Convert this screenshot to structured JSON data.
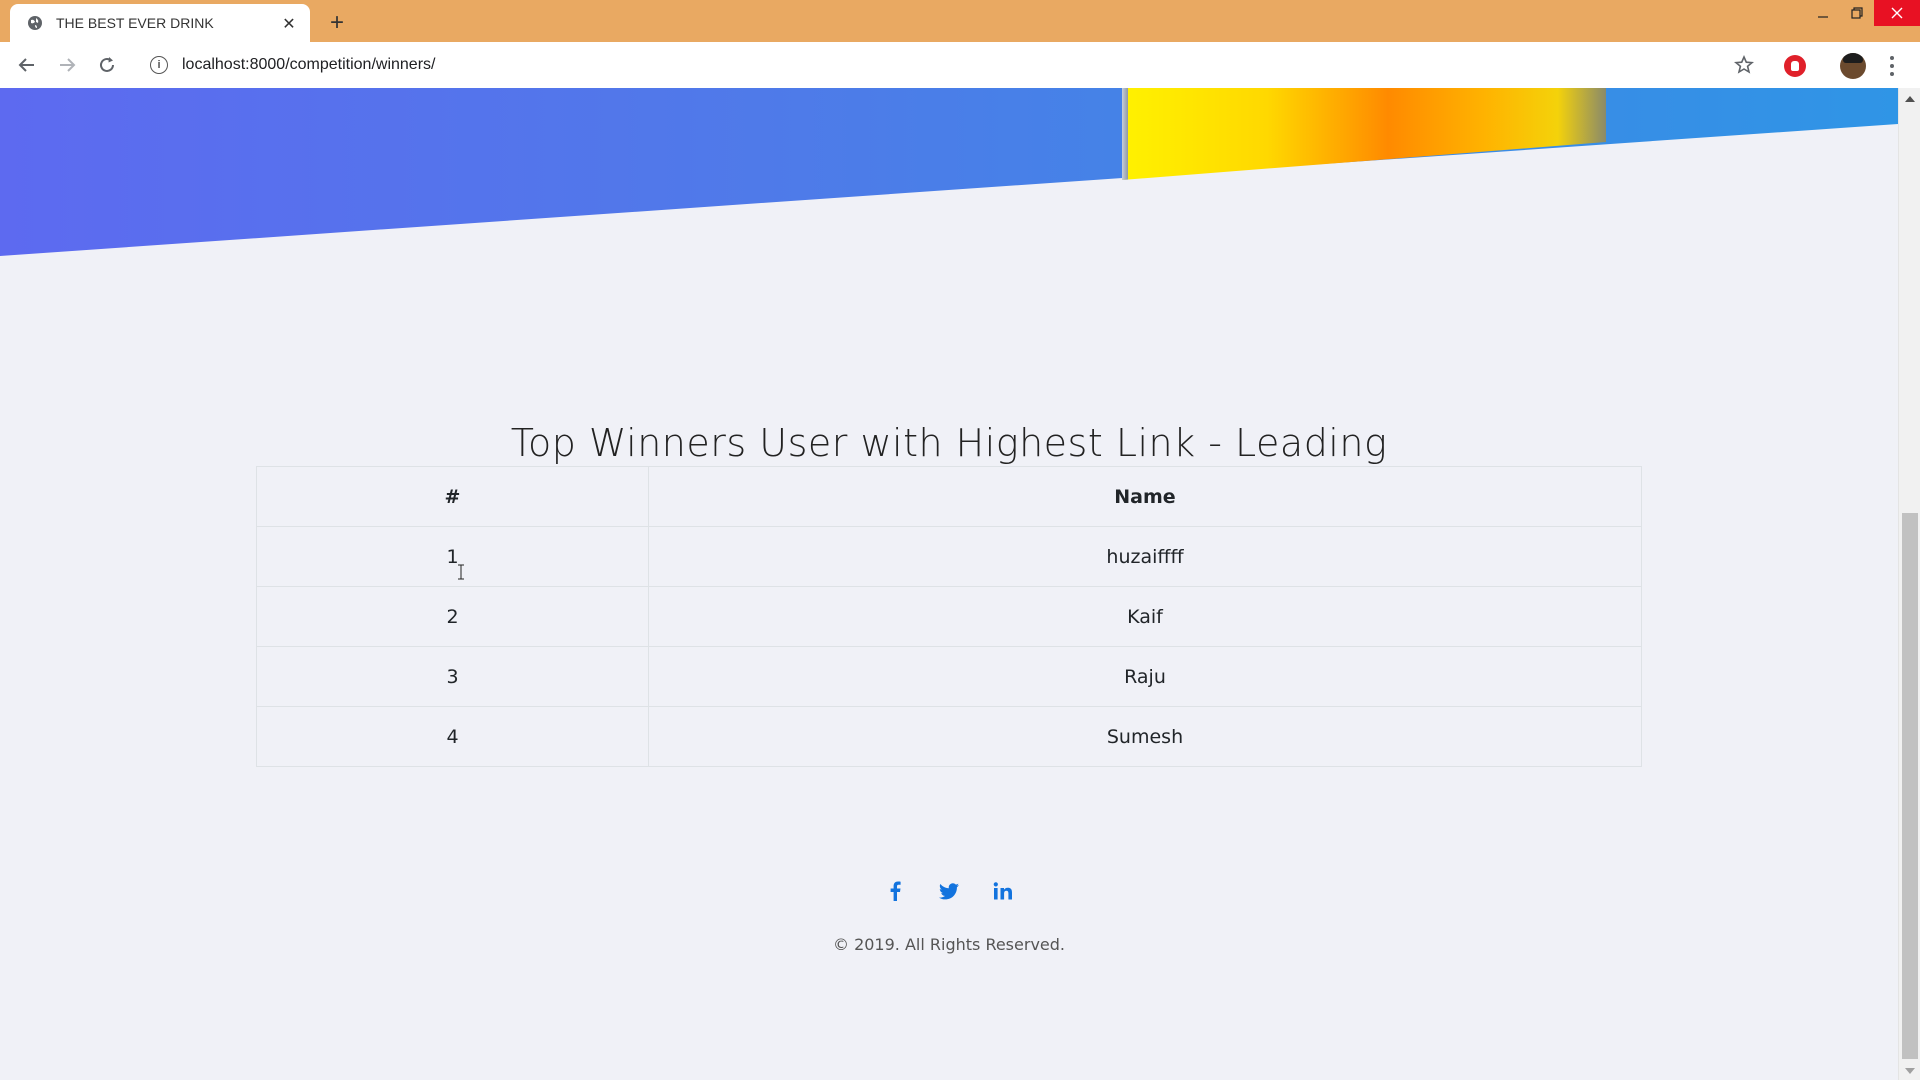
{
  "browser": {
    "tab_title": "THE BEST EVER DRINK",
    "tab_close": "✕",
    "new_tab": "+",
    "url": "localhost:8000/competition/winners/",
    "accent_color": "#e9a962"
  },
  "page": {
    "title": "Top Winners User with Highest Link - Leading",
    "table": {
      "headers": [
        "#",
        "Name"
      ],
      "rows": [
        {
          "rank": "1",
          "name": "huzaiffff"
        },
        {
          "rank": "2",
          "name": "Kaif"
        },
        {
          "rank": "3",
          "name": "Raju"
        },
        {
          "rank": "4",
          "name": "Sumesh"
        }
      ]
    },
    "social_icons": [
      "facebook-icon",
      "twitter-icon",
      "linkedin-icon"
    ],
    "copyright": "© 2019. All Rights Reserved.",
    "link_color": "#1273de"
  }
}
